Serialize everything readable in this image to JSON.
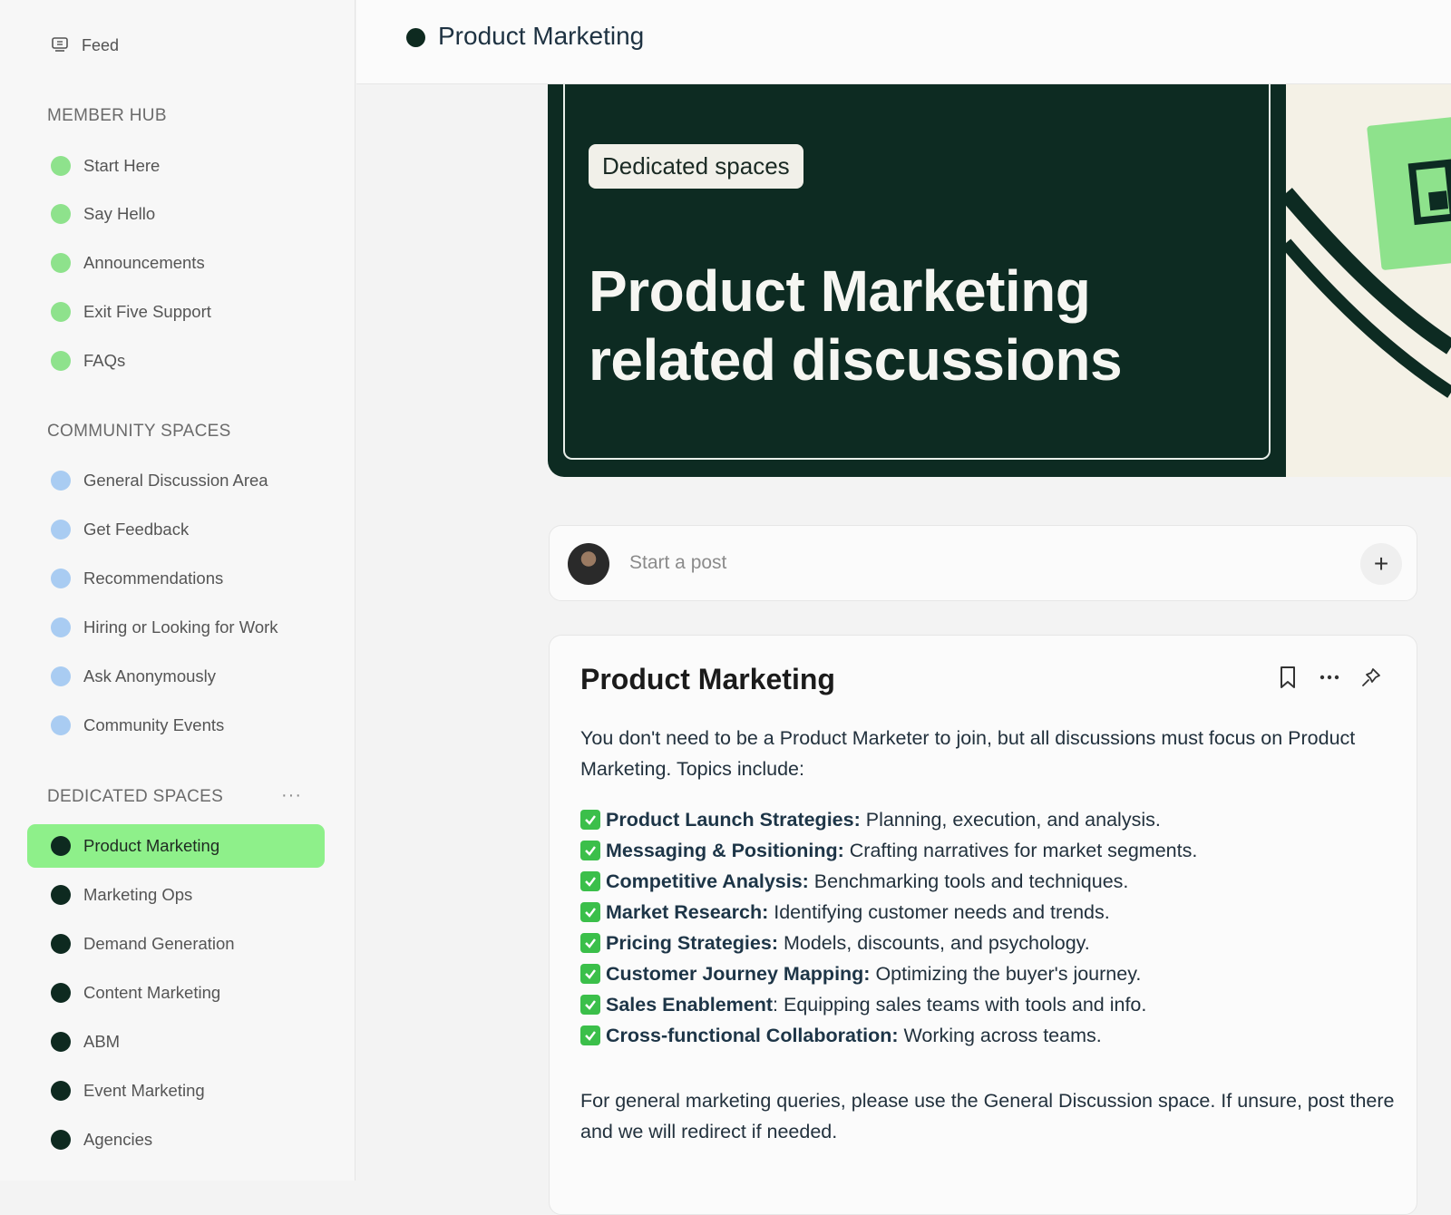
{
  "sidebar": {
    "feed_label": "Feed",
    "member_hub": {
      "title": "MEMBER HUB",
      "items": [
        "Start Here",
        "Say Hello",
        "Announcements",
        "Exit Five Support",
        "FAQs"
      ]
    },
    "community_spaces": {
      "title": "COMMUNITY SPACES",
      "items": [
        "General Discussion Area",
        "Get Feedback",
        "Recommendations",
        "Hiring or Looking for Work",
        "Ask Anonymously",
        "Community Events"
      ]
    },
    "dedicated_spaces": {
      "title": "DEDICATED SPACES",
      "more": "···",
      "items": [
        "Product Marketing",
        "Marketing Ops",
        "Demand Generation",
        "Content Marketing",
        "ABM",
        "Event Marketing",
        "Agencies"
      ],
      "active": "Product Marketing"
    }
  },
  "header": {
    "title": "Product Marketing"
  },
  "banner": {
    "pill": "Dedicated spaces",
    "headline_line1": "Product Marketing",
    "headline_line2": "related discussions"
  },
  "composer": {
    "placeholder": "Start a post",
    "plus": "+"
  },
  "post": {
    "title": "Product Marketing",
    "intro": "You don't need to be a Product Marketer to join, but all discussions must focus on Product Marketing. Topics include:",
    "topics": [
      {
        "label": "Product Launch Strategies:",
        "text": " Planning, execution, and analysis."
      },
      {
        "label": "Messaging & Positioning:",
        "text": " Crafting narratives for market segments."
      },
      {
        "label": "Competitive Analysis:",
        "text": " Benchmarking tools and techniques."
      },
      {
        "label": "Market Research:",
        "text": " Identifying customer needs and trends."
      },
      {
        "label": "Pricing Strategies:",
        "text": " Models, discounts, and psychology."
      },
      {
        "label": "Customer Journey Mapping:",
        "text": " Optimizing the buyer's journey."
      },
      {
        "label": "Sales Enablement",
        "text": ": Equipping sales teams with tools and info."
      },
      {
        "label": "Cross-functional Collaboration:",
        "text": " Working across teams."
      }
    ],
    "outro": "For general marketing queries, please use the General Discussion space. If unsure, post there and we will redirect if needed."
  },
  "colors": {
    "accent_green": "#8ef08a",
    "brand_dark": "#0d2b22",
    "community_blue": "#a9ccf2"
  },
  "icons": [
    "feed-icon",
    "bookmark-icon",
    "more-icon",
    "pin-icon",
    "plus-icon",
    "check-icon"
  ]
}
